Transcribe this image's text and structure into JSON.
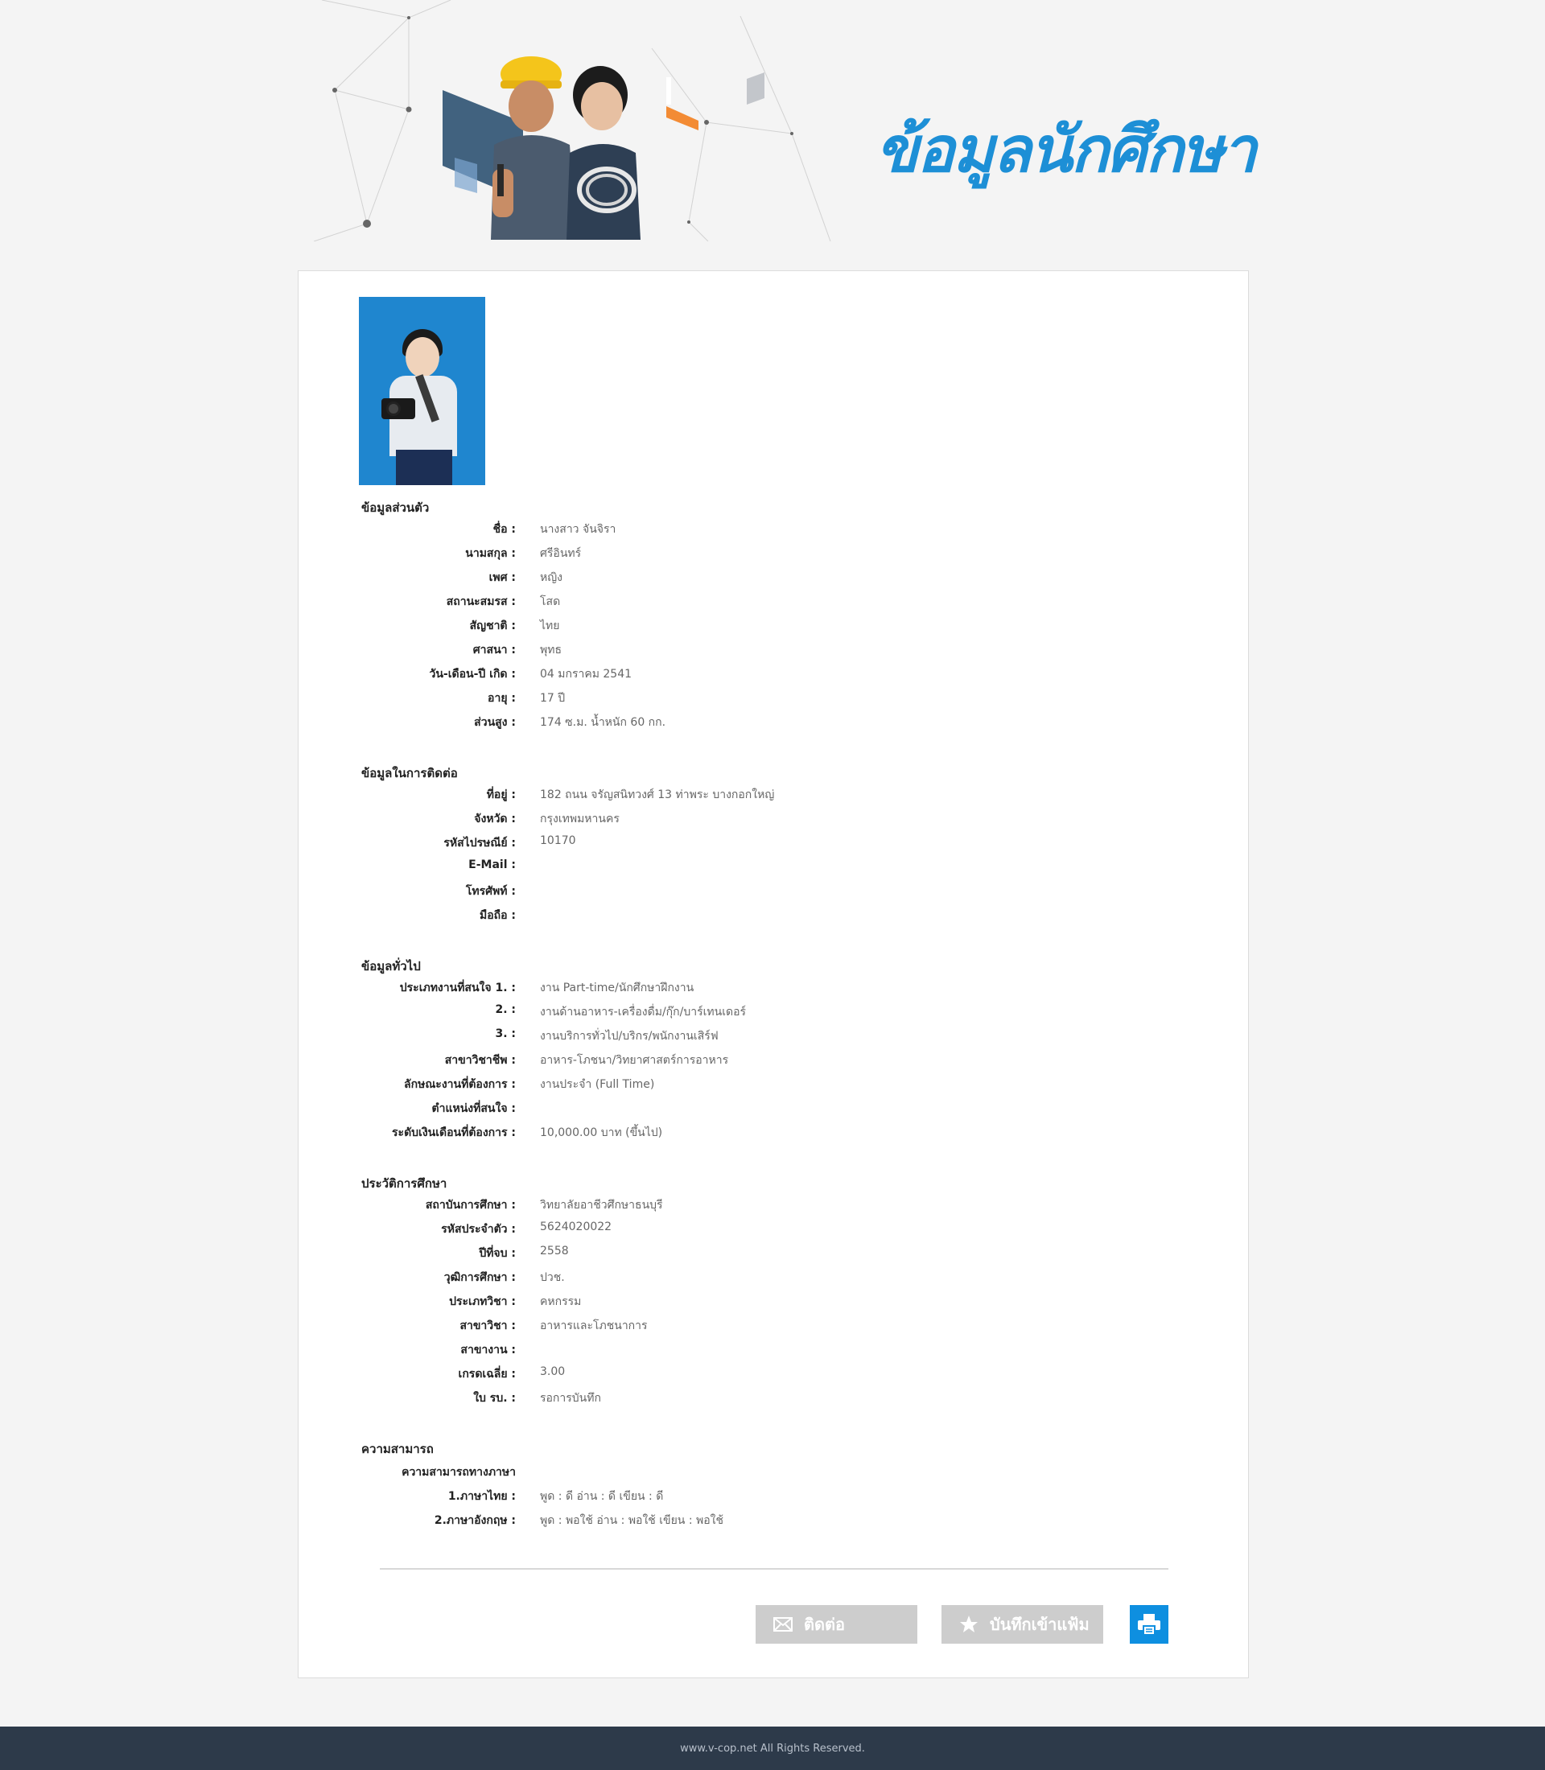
{
  "banner": {
    "title": "ข้อมูลนักศึกษา"
  },
  "sections": {
    "personal": {
      "title": "ข้อมูลส่วนตัว",
      "rows": [
        {
          "label": "ชื่อ :",
          "value": "นางสาว จันจิรา"
        },
        {
          "label": "นามสกุล :",
          "value": "ศรีอินทร์"
        },
        {
          "label": "เพศ :",
          "value": "หญิง"
        },
        {
          "label": "สถานะสมรส :",
          "value": "โสด"
        },
        {
          "label": "สัญชาติ :",
          "value": "ไทย"
        },
        {
          "label": "ศาสนา :",
          "value": "พุทธ"
        },
        {
          "label": "วัน-เดือน-ปี เกิด :",
          "value": "04 มกราคม 2541"
        },
        {
          "label": "อายุ :",
          "value": "17 ปี"
        },
        {
          "label": "ส่วนสูง :",
          "value": "174 ซ.ม. น้ำหนัก 60 กก."
        }
      ]
    },
    "contact": {
      "title": "ข้อมูลในการติดต่อ",
      "rows": [
        {
          "label": "ที่อยู่ :",
          "value": "182 ถนน จรัญสนิทวงศ์ 13 ท่าพระ บางกอกใหญ่"
        },
        {
          "label": "จังหวัด :",
          "value": "กรุงเทพมหานคร"
        },
        {
          "label": "รหัสไปรษณีย์ :",
          "value": "10170"
        },
        {
          "label": "E-Mail :",
          "value": ""
        },
        {
          "label": "โทรศัพท์ :",
          "value": ""
        },
        {
          "label": "มือถือ :",
          "value": ""
        }
      ]
    },
    "general": {
      "title": "ข้อมูลทั่วไป",
      "rows": [
        {
          "label": "ประเภทงานที่สนใจ 1. :",
          "value": "งาน Part-time/นักศึกษาฝึกงาน"
        },
        {
          "label": "2. :",
          "value": "งานด้านอาหาร-เครื่องดื่ม/กุ๊ก/บาร์เทนเดอร์"
        },
        {
          "label": "3. :",
          "value": "งานบริการทั่วไป/บริกร/พนักงานเสิร์ฟ"
        },
        {
          "label": "สาขาวิชาชีพ :",
          "value": "อาหาร-โภชนา/วิทยาศาสตร์การอาหาร"
        },
        {
          "label": "ลักษณะงานที่ต้องการ :",
          "value": "งานประจำ (Full Time)"
        },
        {
          "label": "ตำแหน่งที่สนใจ :",
          "value": ""
        },
        {
          "label": "ระดับเงินเดือนที่ต้องการ :",
          "value": "10,000.00 บาท (ขึ้นไป)"
        }
      ]
    },
    "education": {
      "title": "ประวัติการศึกษา",
      "rows": [
        {
          "label": "สถาบันการศึกษา :",
          "value": "วิทยาลัยอาชีวศึกษาธนบุรี"
        },
        {
          "label": "รหัสประจำตัว :",
          "value": "5624020022"
        },
        {
          "label": "ปีที่จบ :",
          "value": "2558"
        },
        {
          "label": "วุฒิการศึกษา :",
          "value": "ปวช."
        },
        {
          "label": "ประเภทวิชา :",
          "value": "คหกรรม"
        },
        {
          "label": "สาขาวิชา :",
          "value": "อาหารและโภชนาการ"
        },
        {
          "label": "สาขางาน :",
          "value": ""
        },
        {
          "label": "เกรดเฉลี่ย :",
          "value": "3.00"
        },
        {
          "label": "ใบ รบ. :",
          "value": "รอการบันทึก"
        }
      ]
    },
    "ability": {
      "title": "ความสามารถ",
      "subtitle": "ความสามารถทางภาษา",
      "rows": [
        {
          "label": "1.ภาษาไทย :",
          "value": "พูด : ดี  อ่าน : ดี  เขียน : ดี"
        },
        {
          "label": "2.ภาษาอังกฤษ :",
          "value": "พูด : พอใช้  อ่าน : พอใช้  เขียน : พอใช้"
        }
      ]
    }
  },
  "actions": {
    "contact_label": "ติดต่อ",
    "save_label": "บันทึกเข้าแฟ้ม"
  },
  "footer": {
    "text": "www.v-cop.net All Rights Reserved."
  },
  "colors": {
    "accent": "#1d8fd6",
    "footer_bg": "#2d3a4a",
    "print_btn": "#0e8fe0",
    "button_gray": "#cdcdcd"
  }
}
